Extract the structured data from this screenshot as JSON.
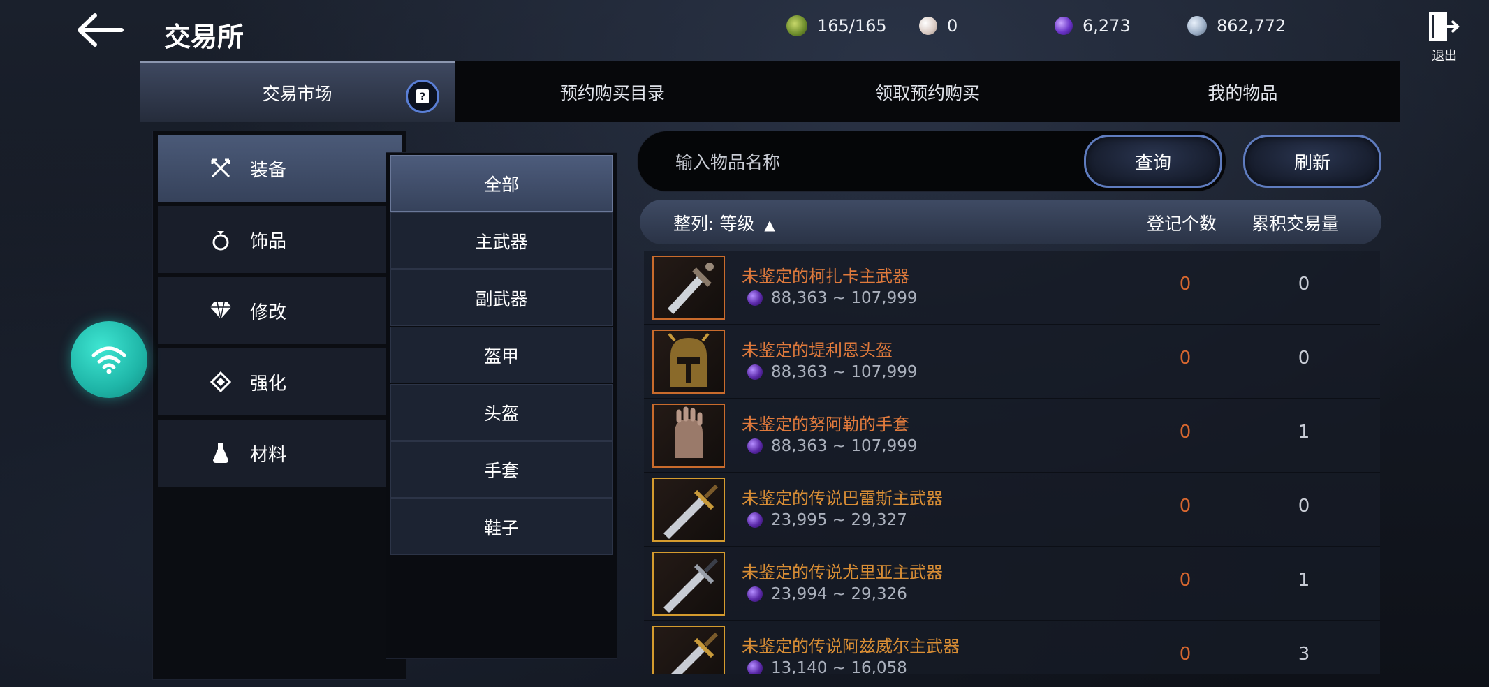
{
  "header": {
    "title": "交易所",
    "exit_label": "退出",
    "currencies": [
      {
        "icon": "stamina-icon",
        "value": "165/165",
        "color": "#8cab3a"
      },
      {
        "icon": "pearl-icon",
        "value": "0",
        "color": "#e8dcd4"
      },
      {
        "icon": "dark-crystal-icon",
        "value": "6,273",
        "color": "#7b3fd6"
      },
      {
        "icon": "silver-coin-icon",
        "value": "862,772",
        "color": "#9fb1c8"
      }
    ]
  },
  "tabs": [
    {
      "label": "交易市场",
      "active": true
    },
    {
      "label": "预约购买目录",
      "active": false
    },
    {
      "label": "领取预约购买",
      "active": false
    },
    {
      "label": "我的物品",
      "active": false
    }
  ],
  "categories": [
    {
      "label": "装备",
      "icon": "crossed-swords-icon",
      "active": true
    },
    {
      "label": "饰品",
      "icon": "ring-icon",
      "active": false
    },
    {
      "label": "修改",
      "icon": "diamond-icon",
      "active": false
    },
    {
      "label": "强化",
      "icon": "enhance-icon",
      "active": false
    },
    {
      "label": "材料",
      "icon": "potion-flask-icon",
      "active": false
    }
  ],
  "subcategories": [
    {
      "label": "全部",
      "active": true
    },
    {
      "label": "主武器",
      "active": false
    },
    {
      "label": "副武器",
      "active": false
    },
    {
      "label": "盔甲",
      "active": false
    },
    {
      "label": "头盔",
      "active": false
    },
    {
      "label": "手套",
      "active": false
    },
    {
      "label": "鞋子",
      "active": false
    }
  ],
  "search": {
    "placeholder": "输入物品名称",
    "query_label": "查询",
    "refresh_label": "刷新"
  },
  "list_header": {
    "sort_label": "整列: 等级",
    "sort_arrow": "▲",
    "count_label": "登记个数",
    "volume_label": "累积交易量"
  },
  "items": [
    {
      "name": "未鉴定的柯扎卡主武器",
      "price": "88,363 ~ 107,999",
      "count": "0",
      "volume": "0",
      "grade": "orange",
      "icon": "dagger-icon"
    },
    {
      "name": "未鉴定的堤利恩头盔",
      "price": "88,363 ~ 107,999",
      "count": "0",
      "volume": "0",
      "grade": "orange",
      "icon": "helmet-icon"
    },
    {
      "name": "未鉴定的努阿勒的手套",
      "price": "88,363 ~ 107,999",
      "count": "0",
      "volume": "1",
      "grade": "orange",
      "icon": "gauntlet-icon"
    },
    {
      "name": "未鉴定的传说巴雷斯主武器",
      "price": "23,995 ~ 29,327",
      "count": "0",
      "volume": "0",
      "grade": "gold",
      "icon": "sword-icon"
    },
    {
      "name": "未鉴定的传说尤里亚主武器",
      "price": "23,994 ~ 29,326",
      "count": "0",
      "volume": "1",
      "grade": "gold",
      "icon": "sword-icon"
    },
    {
      "name": "未鉴定的传说阿兹威尔主武器",
      "price": "13,140 ~ 16,058",
      "count": "0",
      "volume": "3",
      "grade": "gold",
      "icon": "sword-icon"
    }
  ]
}
